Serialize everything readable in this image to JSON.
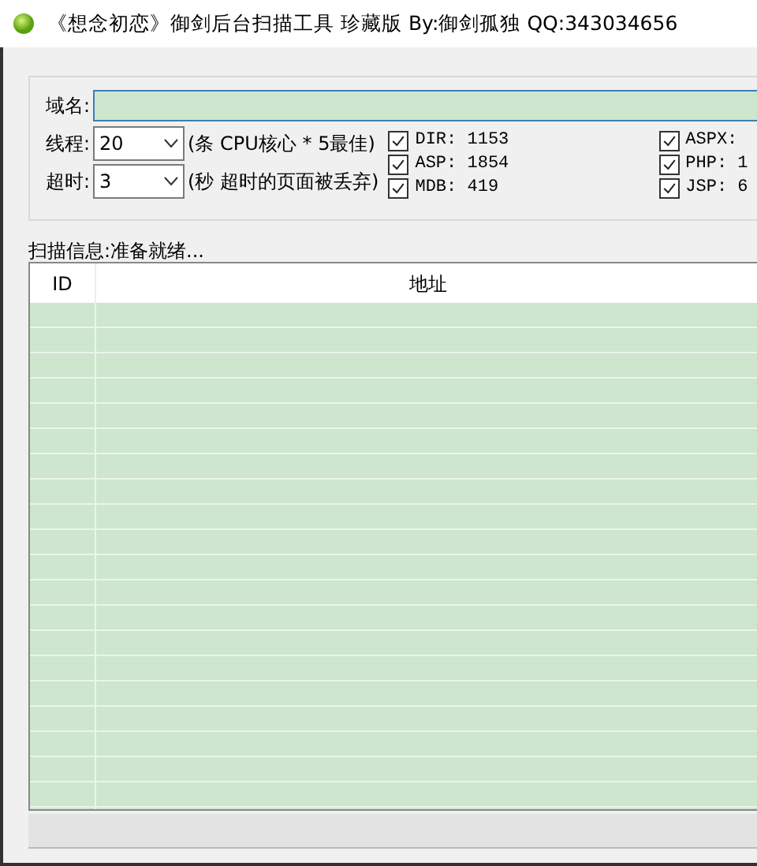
{
  "window": {
    "title": "《想念初恋》御剑后台扫描工具 珍藏版 By:御剑孤独 QQ:343034656"
  },
  "domain": {
    "label": "域名:"
  },
  "threads": {
    "label": "线程:",
    "value": "20",
    "note": "(条 CPU核心 * 5最佳)"
  },
  "timeout": {
    "label": "超时:",
    "value": "3",
    "note": "(秒 超时的页面被丢弃)"
  },
  "dictionaries": [
    {
      "label": "DIR: 1153",
      "checked": true
    },
    {
      "label": "ASP: 1854",
      "checked": true
    },
    {
      "label": "MDB: 419",
      "checked": true
    },
    {
      "label": "ASPX:",
      "checked": true
    },
    {
      "label": "PHP: 1",
      "checked": true
    },
    {
      "label": "JSP: 6",
      "checked": true
    }
  ],
  "status": {
    "label": "扫描信息:",
    "text": "准备就绪..."
  },
  "table": {
    "columns": [
      "ID",
      "地址"
    ]
  }
}
